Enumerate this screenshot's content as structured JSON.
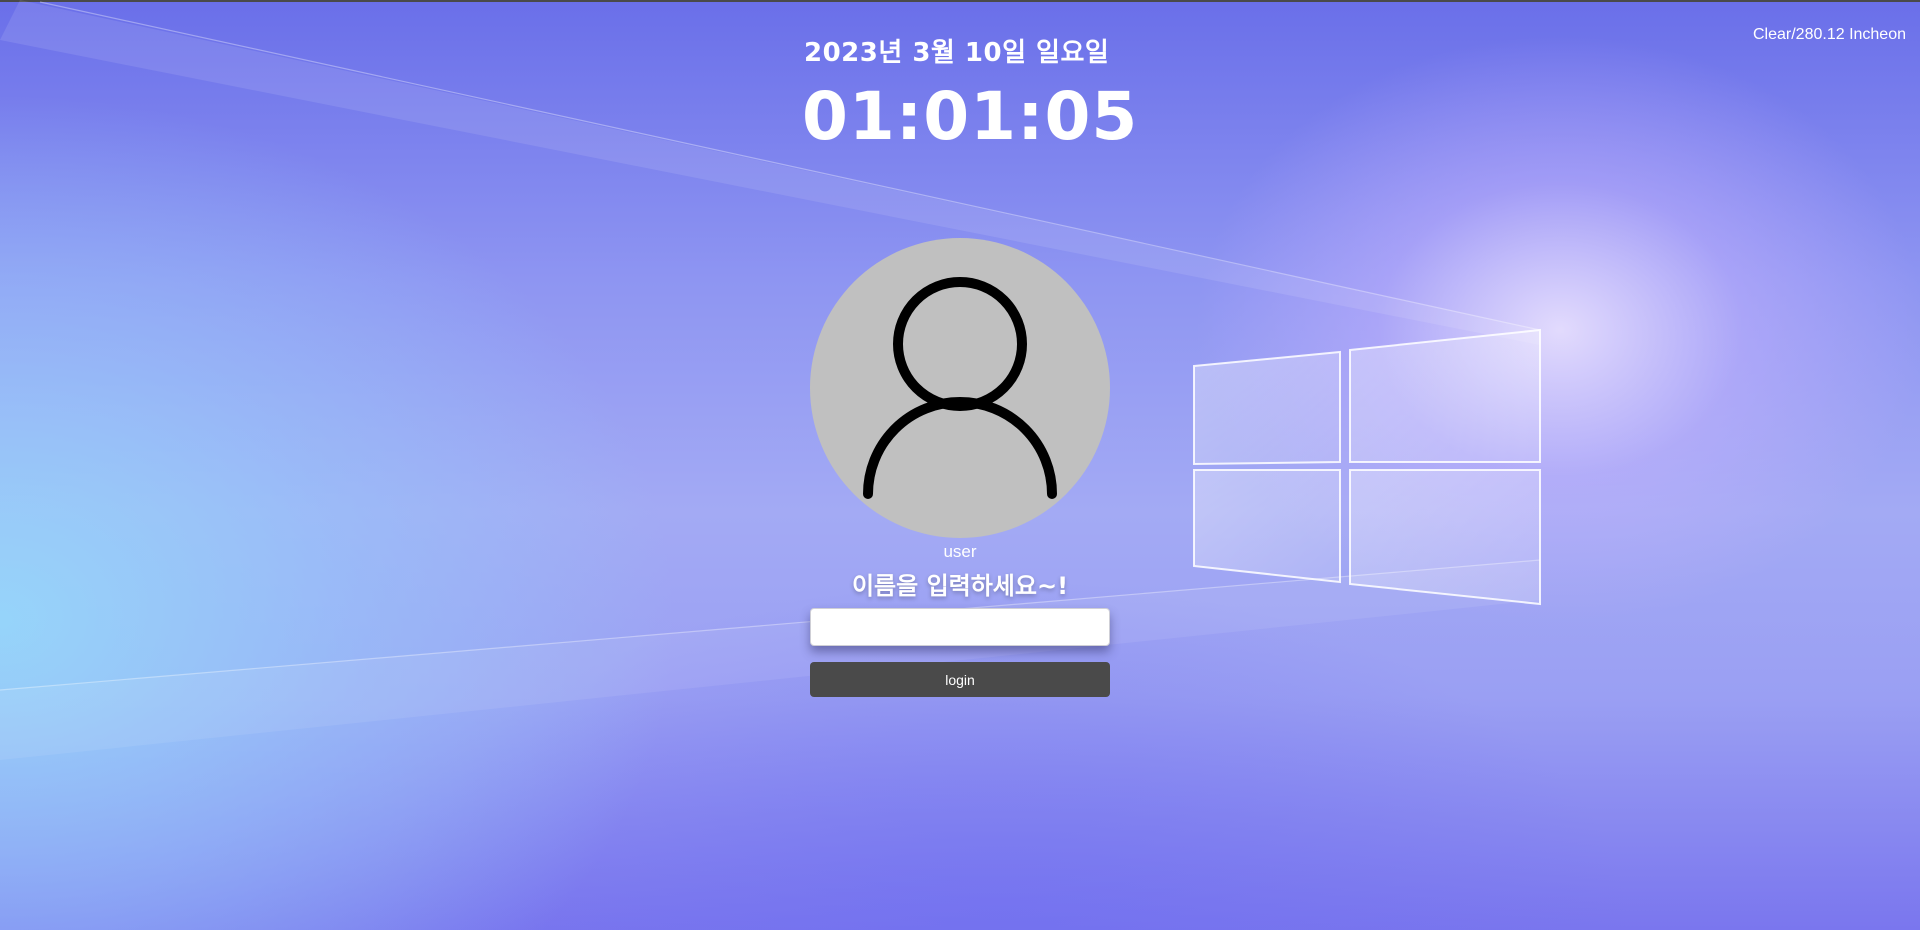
{
  "weather": {
    "text": "Clear/280.12 Incheon"
  },
  "date": {
    "text": "2023년 3월 10일 일요일"
  },
  "clock": {
    "text": "01:01:05"
  },
  "user": {
    "avatar_icon": "user-silhouette-icon",
    "name": "user"
  },
  "login_form": {
    "prompt": "이름을 입력하세요~!",
    "input_value": "",
    "input_placeholder": "",
    "button_label": "login"
  },
  "colors": {
    "button_bg": "#4a4a4a",
    "avatar_bg": "#c0c0c0",
    "text": "#ffffff"
  }
}
